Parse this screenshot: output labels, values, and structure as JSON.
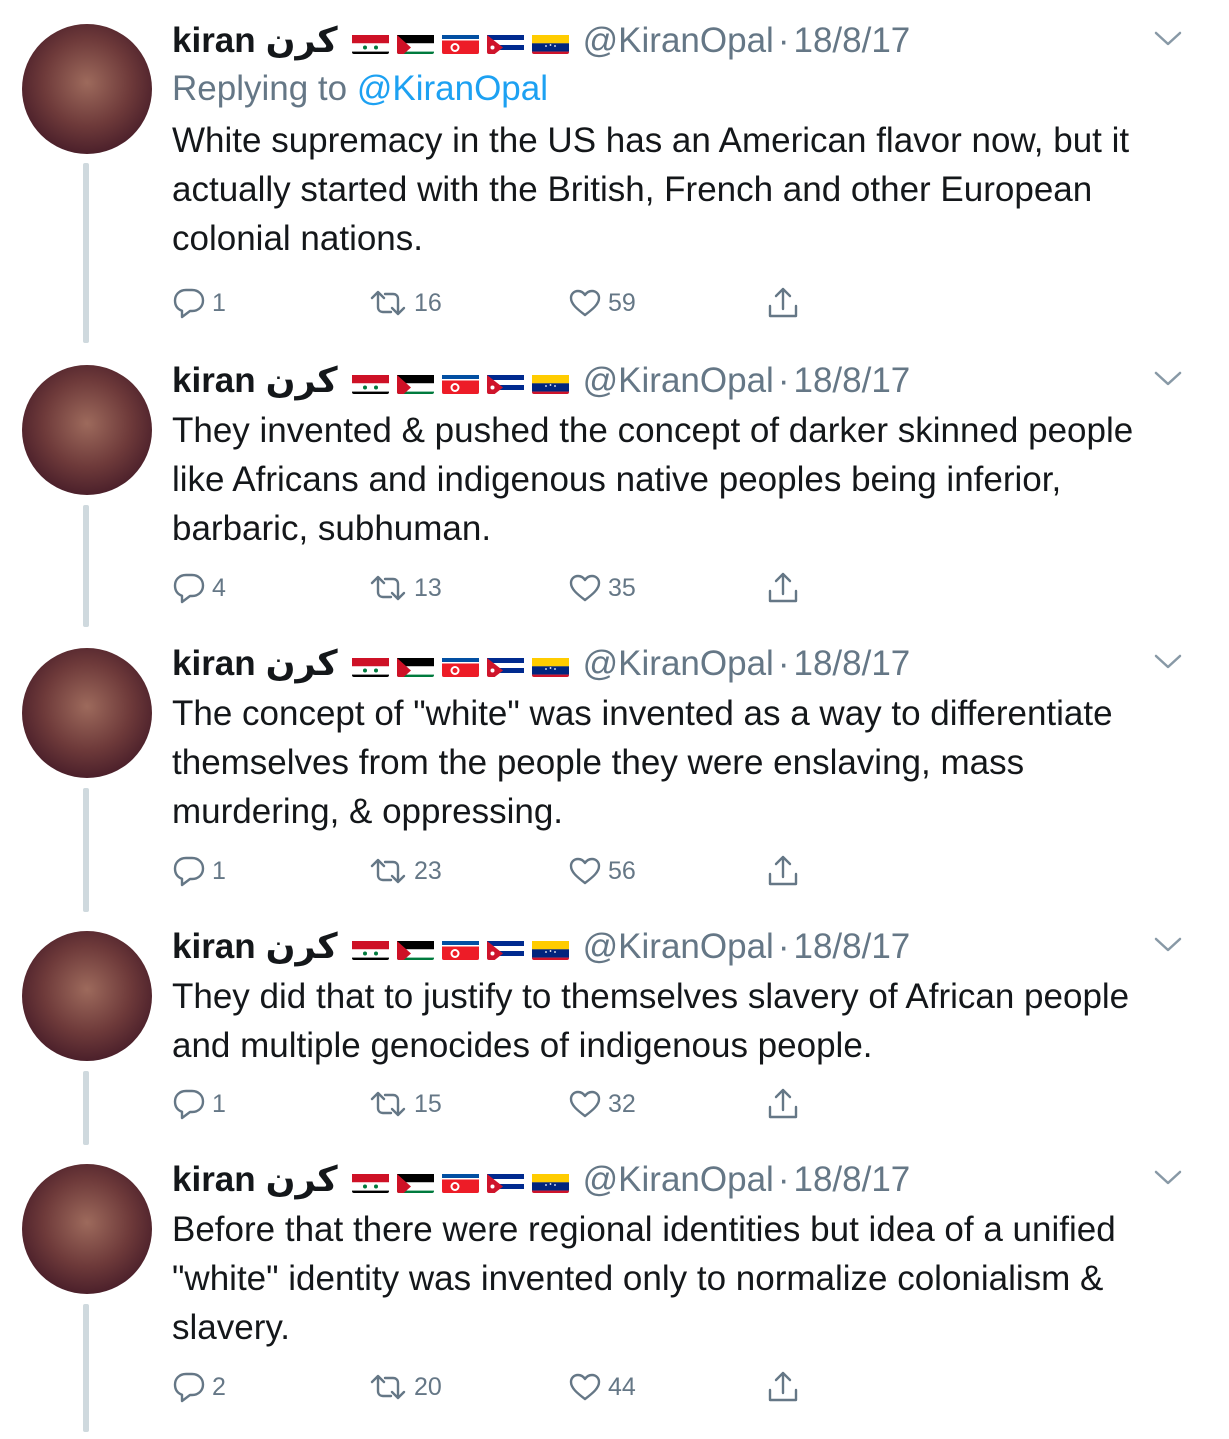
{
  "author": {
    "name": "kiran",
    "arabic_name": "كرن",
    "handle": "@KiranOpal",
    "date": "18/8/17",
    "flags": [
      "syria-flag",
      "palestine-flag",
      "north-korea-flag",
      "cuba-flag",
      "venezuela-flag"
    ]
  },
  "reply_prefix": "Replying to",
  "reply_to": "@KiranOpal",
  "tweets": [
    {
      "text": "White supremacy in the US has an American flavor now, but it actually started with the British, French and other European colonial nations.",
      "replies": "1",
      "retweets": "16",
      "likes": "59"
    },
    {
      "text": "They invented & pushed the concept of darker skinned people like Africans and indigenous native peoples being inferior, barbaric, subhuman.",
      "replies": "4",
      "retweets": "13",
      "likes": "35"
    },
    {
      "text": "The concept of \"white\" was invented as a way to differentiate themselves from the people they were enslaving, mass murdering, & oppressing.",
      "replies": "1",
      "retweets": "23",
      "likes": "56"
    },
    {
      "text": "They did that to justify to themselves slavery of African people and multiple genocides of indigenous people.",
      "replies": "1",
      "retweets": "15",
      "likes": "32"
    },
    {
      "text": "Before that there were regional identities but idea of a unified \"white\" identity was invented only to normalize colonialism & slavery.",
      "replies": "2",
      "retweets": "20",
      "likes": "44"
    }
  ],
  "colors": {
    "accent": "#1da1f2",
    "muted": "#657786",
    "thread": "#cfd9de"
  }
}
